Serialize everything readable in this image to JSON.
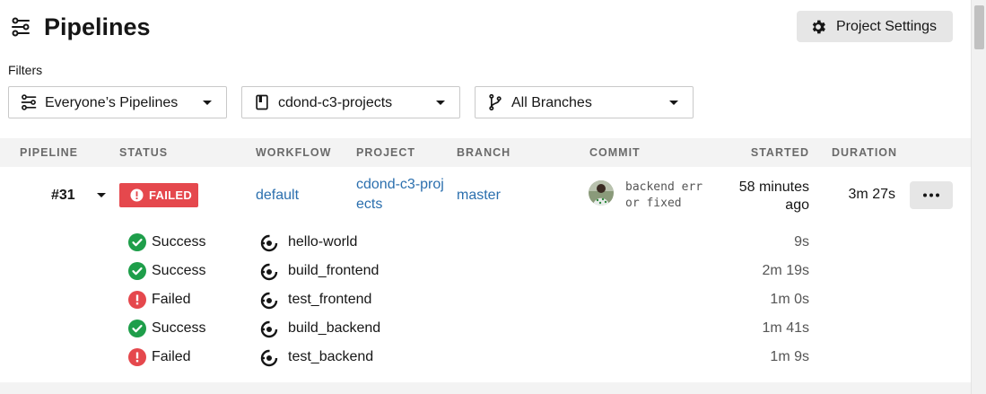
{
  "header": {
    "title": "Pipelines",
    "title_icon": "pipelines-icon",
    "settings_label": "Project Settings",
    "settings_icon": "gear-icon"
  },
  "filters": {
    "label": "Filters",
    "pipelines_filter": "Everyone’s Pipelines",
    "project_filter": "cdond-c3-projects",
    "branch_filter": "All Branches"
  },
  "columns": {
    "pipeline": "PIPELINE",
    "status": "STATUS",
    "workflow": "WORKFLOW",
    "project": "PROJECT",
    "branch": "BRANCH",
    "commit": "COMMIT",
    "started": "STARTED",
    "duration": "DURATION"
  },
  "pipeline": {
    "number": "#31",
    "status": "FAILED",
    "workflow": "default",
    "project": "cdond-c3-projects",
    "branch": "master",
    "commit_message": "backend err or fixed",
    "started": "58 minutes ago",
    "duration": "3m 27s"
  },
  "jobs": [
    {
      "status": "Success",
      "state": "success",
      "name": "hello-world",
      "duration": "9s"
    },
    {
      "status": "Success",
      "state": "success",
      "name": "build_frontend",
      "duration": "2m 19s"
    },
    {
      "status": "Failed",
      "state": "failed",
      "name": "test_frontend",
      "duration": "1m 0s"
    },
    {
      "status": "Success",
      "state": "success",
      "name": "build_backend",
      "duration": "1m 41s"
    },
    {
      "status": "Failed",
      "state": "failed",
      "name": "test_backend",
      "duration": "1m 9s"
    }
  ],
  "colors": {
    "success": "#1e9e4a",
    "failed": "#e5484d",
    "link": "#2b6fae",
    "header_bg": "#f3f3f3"
  }
}
